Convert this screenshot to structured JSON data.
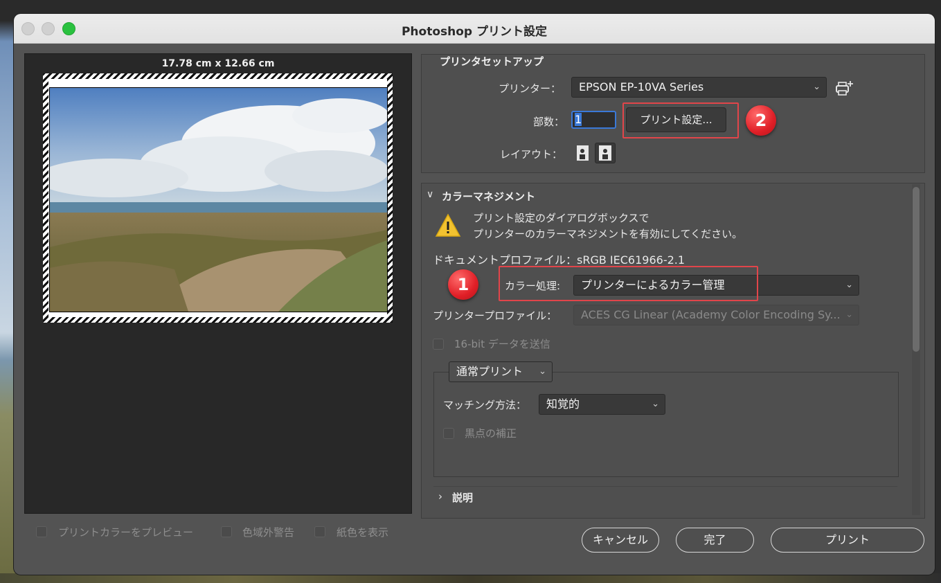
{
  "window": {
    "title": "Photoshop プリント設定"
  },
  "preview": {
    "dimensions": "17.78 cm x 12.66 cm",
    "options": [
      {
        "label": "プリントカラーをプレビュー",
        "checked": false
      },
      {
        "label": "色域外警告",
        "checked": false
      },
      {
        "label": "紙色を表示",
        "checked": false
      }
    ]
  },
  "printer_setup": {
    "heading": "プリンタセットアップ",
    "printer_label": "プリンター：",
    "printer_value": "EPSON EP-10VA Series",
    "copies_label": "部数：",
    "copies_value": "1",
    "print_settings_button": "プリント設定...",
    "layout_label": "レイアウト：",
    "add_printer_icon": "printer-add-icon"
  },
  "color_management": {
    "heading": "カラーマネジメント",
    "warning_line1": "プリント設定のダイアログボックスで",
    "warning_line2": "プリンターのカラーマネジメントを有効にしてください。",
    "document_profile": "ドキュメントプロファイル：sRGB IEC61966-2.1",
    "color_handling_label": "カラー処理:",
    "color_handling_value": "プリンターによるカラー管理",
    "printer_profile_label": "プリンタープロファイル：",
    "printer_profile_value": "ACES CG Linear (Academy Color Encoding Sy...",
    "send_16bit": "16-bit データを送信",
    "print_mode": "通常プリント",
    "matching_label": "マッチング方法：",
    "matching_value": "知覚的",
    "black_point": "黒点の補正",
    "description": "説明"
  },
  "annotations": {
    "badge1": "1",
    "badge2": "2",
    "highlight_color": "#e2454a"
  },
  "buttons": {
    "cancel": "キャンセル",
    "done": "完了",
    "print": "プリント"
  }
}
